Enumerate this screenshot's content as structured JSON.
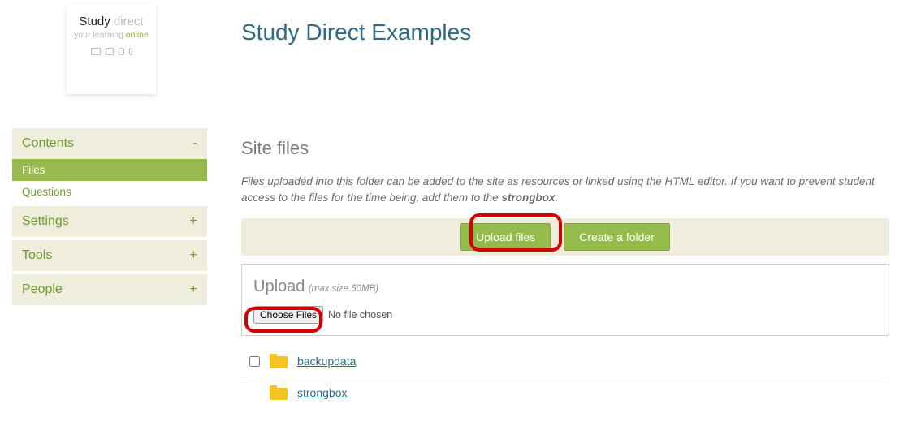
{
  "logo": {
    "title_strong": "Study",
    "title_light": "direct",
    "sub_muted": "your learning",
    "sub_green": "online"
  },
  "header": {
    "page_title": "Study Direct Examples"
  },
  "sidebar": {
    "blocks": [
      {
        "label": "Contents",
        "toggle": "-",
        "items": [
          {
            "label": "Files",
            "active": true
          },
          {
            "label": "Questions",
            "active": false
          }
        ]
      },
      {
        "label": "Settings",
        "toggle": "+"
      },
      {
        "label": "Tools",
        "toggle": "+"
      },
      {
        "label": "People",
        "toggle": "+"
      }
    ]
  },
  "main": {
    "heading": "Site files",
    "help_pre": "Files uploaded into this folder can be added to the site as resources or linked using the HTML editor. If you want to prevent student access to the files for the time being, add them to the ",
    "help_bold": "strongbox",
    "help_post": ".",
    "actions": {
      "upload": "Upload files",
      "create_folder": "Create a folder"
    },
    "upload_panel": {
      "title": "Upload",
      "hint": "(max size 60MB)",
      "choose_label": "Choose Files",
      "no_file": "No file chosen"
    },
    "files": [
      {
        "name": "backupdata",
        "has_checkbox": true
      },
      {
        "name": "strongbox",
        "has_checkbox": false
      }
    ]
  }
}
